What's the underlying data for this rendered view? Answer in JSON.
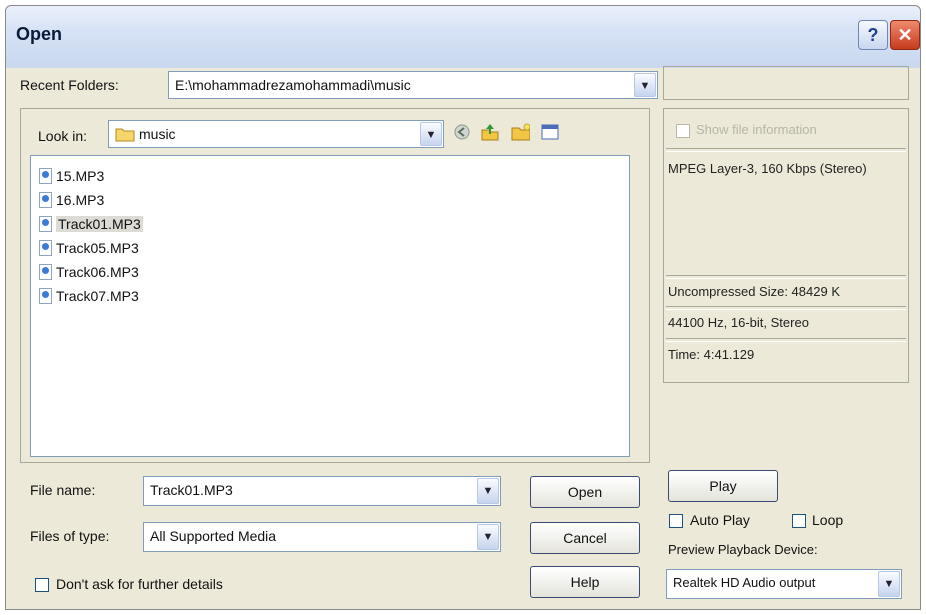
{
  "window": {
    "title": "Open"
  },
  "recent_folders": {
    "label": "Recent Folders:",
    "value": "E:\\mohammadrezamohammadi\\music"
  },
  "look_in": {
    "label": "Look in:",
    "value": "music"
  },
  "files": [
    {
      "name": "15.MP3",
      "selected": false
    },
    {
      "name": "16.MP3",
      "selected": false
    },
    {
      "name": "Track01.MP3",
      "selected": true
    },
    {
      "name": "Track05.MP3",
      "selected": false
    },
    {
      "name": "Track06.MP3",
      "selected": false
    },
    {
      "name": "Track07.MP3",
      "selected": false
    }
  ],
  "file_name": {
    "label": "File name:",
    "value": "Track01.MP3"
  },
  "files_of_type": {
    "label": "Files of type:",
    "value": "All Supported Media"
  },
  "buttons": {
    "open": "Open",
    "cancel": "Cancel",
    "help": "Help",
    "play": "Play"
  },
  "dont_ask": {
    "label": "Don't ask for further details",
    "checked": false
  },
  "info": {
    "show_label": "Show file information",
    "format": "MPEG Layer-3, 160 Kbps (Stereo)",
    "uncompressed": "Uncompressed Size: 48429 K",
    "rate": "44100 Hz, 16-bit, Stereo",
    "time": "Time:  4:41.129"
  },
  "auto_play": {
    "label": "Auto Play",
    "checked": false
  },
  "loop": {
    "label": "Loop",
    "checked": false
  },
  "preview_device": {
    "label": "Preview Playback Device:",
    "value": "Realtek HD Audio output"
  },
  "icons": {
    "folder": "folder-icon",
    "back": "back-icon",
    "up": "up-folder-icon",
    "new_folder": "new-folder-icon",
    "views": "views-menu-icon"
  }
}
